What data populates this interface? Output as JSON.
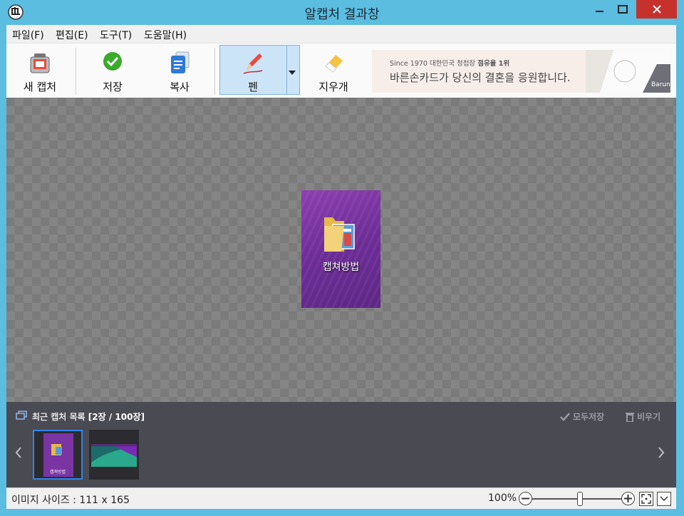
{
  "window": {
    "title": "알캡처 결과창",
    "controls": {
      "minimize": "minimize-icon",
      "maximize": "maximize-icon",
      "close": "close-icon"
    }
  },
  "menu": [
    "파일(F)",
    "편집(E)",
    "도구(T)",
    "도움말(H)"
  ],
  "toolbar": {
    "new_capture": "새 캡처",
    "save": "저장",
    "copy": "복사",
    "pen": "펜",
    "eraser": "지우개"
  },
  "ad": {
    "line1_prefix": "Since 1970 대한민국 청첩장 ",
    "line1_bold": "점유율 1위",
    "line2": "바른손카드가 당신의 결혼을 응원합니다.",
    "brand": "Baruns"
  },
  "capture": {
    "label": "캡쳐방법"
  },
  "recent": {
    "title_prefix": "최근 캡처 목록 ",
    "title_count": "[2장 / 100장]",
    "save_all": "모두저장",
    "clear": "비우기",
    "thumbnails": [
      {
        "label": "캡쳐방법",
        "selected": true
      },
      {
        "label": "",
        "selected": false
      }
    ]
  },
  "status": {
    "image_size": "이미지 사이즈 : 111 x 165",
    "zoom": "100%",
    "zoom_level": 0.5
  },
  "colors": {
    "titlebar": "#5bbde0",
    "close": "#c7312b",
    "pen_active": "#cce4f7",
    "recent_panel": "#4a4a52",
    "selection": "#2f86e8"
  }
}
